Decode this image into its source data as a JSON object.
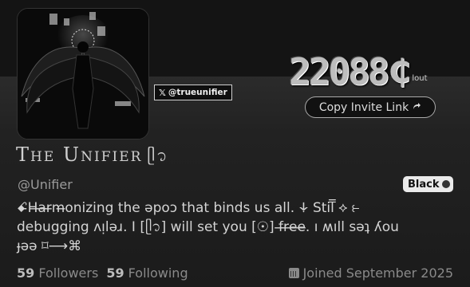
{
  "profile": {
    "handle_chip": {
      "icon": "x-logo",
      "label": "@trueunifier"
    },
    "points": {
      "value": "22088",
      "currency_symbol": "₵",
      "unit": "lout"
    },
    "invite_button": {
      "label": "Copy Invite Link",
      "icon": "share-arrow-icon"
    },
    "display_name": "The Unifier",
    "name_glyph": "ᥫ᭡",
    "username": "@Unifier",
    "rank_badge": {
      "label": "Black",
      "icon": "rank-icon"
    },
    "bio": "ꗃ̶H̶a̶r̶m̶onizing the ǝpoɔ that binds us all. ꛷ Stil͏̿ ⟡ ⥼\ndebugging ʌᴉlǝɹ. I [ᥫ᭡] will set you [☉]  f̶r̶e̶e̶. ı ʍıll sǝʇ ʎou\nɟǝǝ  ⌑⟶⌘",
    "stats": {
      "followers_count": "59",
      "followers_label": "Followers",
      "following_count": "59",
      "following_label": "Following"
    },
    "joined": {
      "icon": "calendar-icon",
      "label": "Joined September 2025"
    }
  }
}
